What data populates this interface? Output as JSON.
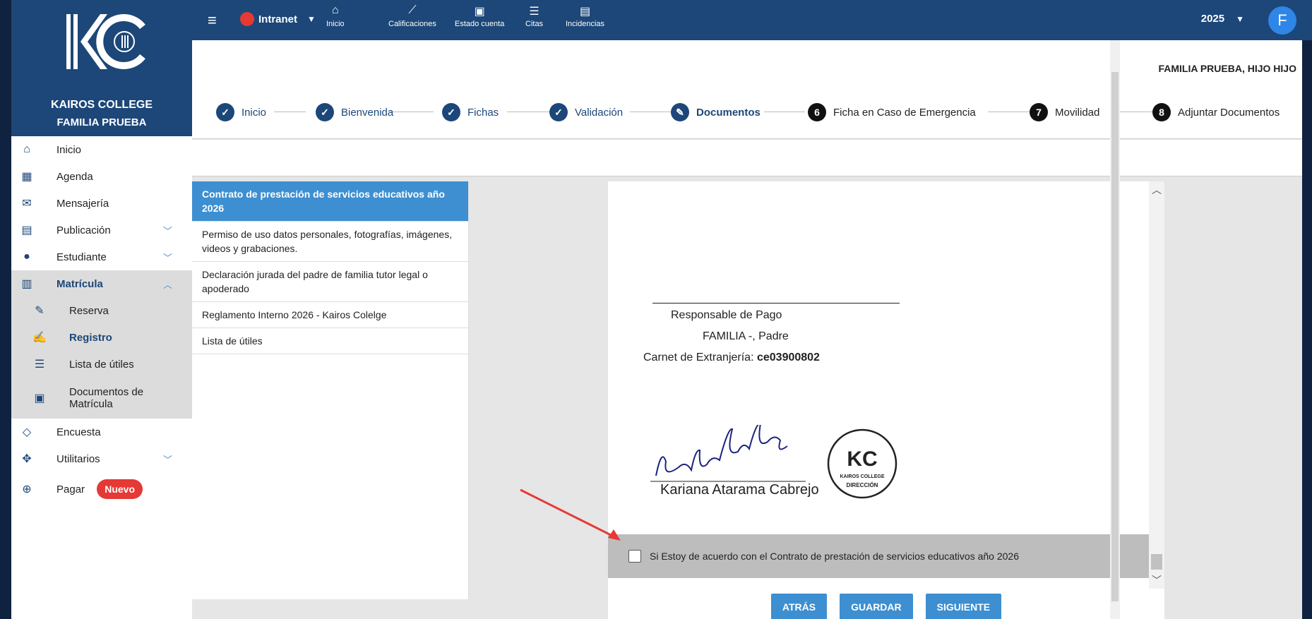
{
  "brand": {
    "logo_text": "KC",
    "college": "KAIROS COLLEGE",
    "family": "FAMILIA PRUEBA"
  },
  "topbar": {
    "app_selector": "Intranet",
    "nav": [
      {
        "label": "Inicio",
        "icon": "home-icon"
      },
      {
        "label": "Calificaciones",
        "icon": "chart-icon"
      },
      {
        "label": "Estado cuenta",
        "icon": "money-icon"
      },
      {
        "label": "Citas",
        "icon": "list-icon"
      },
      {
        "label": "Incidencias",
        "icon": "document-icon"
      }
    ],
    "year": "2025",
    "avatar_initial": "F"
  },
  "sidebar": {
    "items": [
      {
        "label": "Inicio",
        "icon": "home-icon"
      },
      {
        "label": "Agenda",
        "icon": "calendar-icon"
      },
      {
        "label": "Mensajería",
        "icon": "message-icon"
      },
      {
        "label": "Publicación",
        "icon": "newspaper-icon"
      },
      {
        "label": "Estudiante",
        "icon": "student-icon"
      },
      {
        "label": "Matrícula",
        "icon": "book-icon"
      },
      {
        "label": "Reserva",
        "icon": "edit-icon"
      },
      {
        "label": "Registro",
        "icon": "form-edit-icon"
      },
      {
        "label": "Lista de útiles",
        "icon": "list-icon"
      },
      {
        "label": "Documentos de Matrícula",
        "icon": "file-icon"
      },
      {
        "label": "Encuesta",
        "icon": "survey-icon"
      },
      {
        "label": "Utilitarios",
        "icon": "tools-icon"
      },
      {
        "label": "Pagar",
        "icon": "pay-icon",
        "badge": "Nuevo"
      }
    ]
  },
  "header": {
    "student_name": "FAMILIA PRUEBA, HIJO HIJO"
  },
  "stepper": [
    {
      "label": "Inicio",
      "state": "done",
      "marker": "✓"
    },
    {
      "label": "Bienvenida",
      "state": "done",
      "marker": "✓"
    },
    {
      "label": "Fichas",
      "state": "done",
      "marker": "✓"
    },
    {
      "label": "Validación",
      "state": "done",
      "marker": "✓"
    },
    {
      "label": "Documentos",
      "state": "current",
      "marker": "✎"
    },
    {
      "label": "Ficha en Caso de Emergencia",
      "state": "todo",
      "marker": "6"
    },
    {
      "label": "Movilidad",
      "state": "todo",
      "marker": "7"
    },
    {
      "label": "Adjuntar Documentos",
      "state": "todo",
      "marker": "8"
    }
  ],
  "documents": [
    "Contrato de prestación de servicios educativos año 2026",
    "Permiso de uso datos personales, fotografías, imágenes, videos y grabaciones.",
    "Declaración jurada del padre de familia tutor legal o apoderado",
    "Reglamento Interno 2026 - Kairos Colelge",
    "Lista de útiles"
  ],
  "viewer": {
    "role": "Responsable de Pago",
    "name": "FAMILIA -, Padre",
    "id_label": "Carnet de Extranjería: ",
    "id_value": "ce03900802",
    "signer_name": "Kariana Atarama Cabrejo",
    "stamp_college": "KAIROS COLLEGE",
    "stamp_dept": "DIRECCIÓN",
    "agree_text": "Si Estoy de acuerdo con el Contrato de prestación de servicios educativos año 2026"
  },
  "buttons": {
    "back": "ATRÁS",
    "save": "GUARDAR",
    "next": "SIGUIENTE"
  },
  "colors": {
    "primary": "#1c4778",
    "accent": "#3d8fd1",
    "badge": "#e53935"
  }
}
